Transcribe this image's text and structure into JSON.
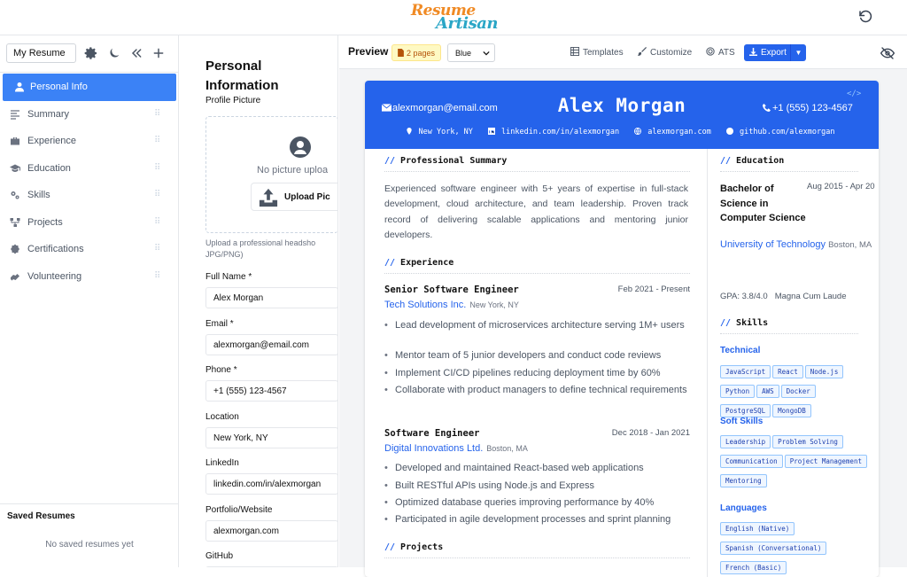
{
  "app": {
    "logo_line1": "Resume",
    "logo_line2": "Artisan"
  },
  "sidebar": {
    "resume_name": "My Resume",
    "items": [
      {
        "label": "Personal Info",
        "icon": "user-icon"
      },
      {
        "label": "Summary",
        "icon": "lines-icon"
      },
      {
        "label": "Experience",
        "icon": "briefcase-icon"
      },
      {
        "label": "Education",
        "icon": "graduation-cap-icon"
      },
      {
        "label": "Skills",
        "icon": "cogs-icon"
      },
      {
        "label": "Projects",
        "icon": "sitemap-icon"
      },
      {
        "label": "Certifications",
        "icon": "certificate-icon"
      },
      {
        "label": "Volunteering",
        "icon": "hands-icon"
      }
    ],
    "saved_title": "Saved Resumes",
    "saved_empty": "No saved resumes yet"
  },
  "form": {
    "title": "Personal Information",
    "profile_picture_label": "Profile Picture",
    "no_picture": "No picture uploa",
    "upload_button": "Upload Pic",
    "upload_hint": "Upload a professional headsho JPG/PNG)",
    "fields": [
      {
        "label": "Full Name *",
        "value": "Alex Morgan"
      },
      {
        "label": "Email *",
        "value": "alexmorgan@email.com"
      },
      {
        "label": "Phone *",
        "value": "+1 (555) 123-4567"
      },
      {
        "label": "Location",
        "value": "New York, NY"
      },
      {
        "label": "LinkedIn",
        "value": "linkedin.com/in/alexmorgan"
      },
      {
        "label": "Portfolio/Website",
        "value": "alexmorgan.com"
      },
      {
        "label": "GitHub",
        "value": ""
      }
    ]
  },
  "preview": {
    "title": "Preview",
    "pages": "2 pages",
    "theme": "Blue",
    "templates": "Templates",
    "customize": "Customize",
    "ats": "ATS",
    "export": "Export",
    "export_caret": "▼"
  },
  "resume": {
    "name": "Alex Morgan",
    "code_tag": "</>",
    "email": "alexmorgan@email.com",
    "phone": "+1 (555) 123-4567",
    "location": "New York, NY",
    "linkedin": "linkedin.com/in/alexmorgan",
    "website": "alexmorgan.com",
    "github": "github.com/alexmorgan",
    "section_slash": "//",
    "summary_title": "Professional Summary",
    "summary": "Experienced software engineer with 5+ years of expertise in full-stack development, cloud architecture, and team leadership. Proven track record of delivering scalable applications and mentoring junior developers.",
    "experience_title": "Experience",
    "jobs": [
      {
        "title": "Senior Software Engineer",
        "dates": "Feb 2021 - Present",
        "company": "Tech Solutions Inc.",
        "location": "New York, NY",
        "bullets": [
          "Lead development of microservices architecture serving 1M+ users",
          "Mentor team of 5 junior developers and conduct code reviews",
          "Implement CI/CD pipelines reducing deployment time by 60%",
          "Collaborate with product managers to define technical requirements"
        ]
      },
      {
        "title": "Software Engineer",
        "dates": "Dec 2018 - Jan 2021",
        "company": "Digital Innovations Ltd.",
        "location": "Boston, MA",
        "bullets": [
          "Developed and maintained React-based web applications",
          "Built RESTful APIs using Node.js and Express",
          "Optimized database queries improving performance by 40%",
          "Participated in agile development processes and sprint planning"
        ]
      }
    ],
    "projects_title": "Projects",
    "education_title": "Education",
    "education": {
      "degree": "Bachelor of Science in Computer Science",
      "dates": "Aug 2015 - Apr 20",
      "university": "University of Technology",
      "location": "Boston, MA",
      "gpa": "GPA: 3.8/4.0",
      "honors": "Magna Cum Laude"
    },
    "skills_title": "Skills",
    "skills": [
      {
        "category": "Technical",
        "items": [
          "JavaScript",
          "React",
          "Node.js",
          "Python",
          "AWS",
          "Docker",
          "PostgreSQL",
          "MongoDB"
        ]
      },
      {
        "category": "Soft Skills",
        "items": [
          "Leadership",
          "Problem Solving",
          "Communication",
          "Project Management",
          "Mentoring"
        ]
      },
      {
        "category": "Languages",
        "items": [
          "English (Native)",
          "Spanish (Conversational)",
          "French (Basic)"
        ]
      }
    ]
  }
}
